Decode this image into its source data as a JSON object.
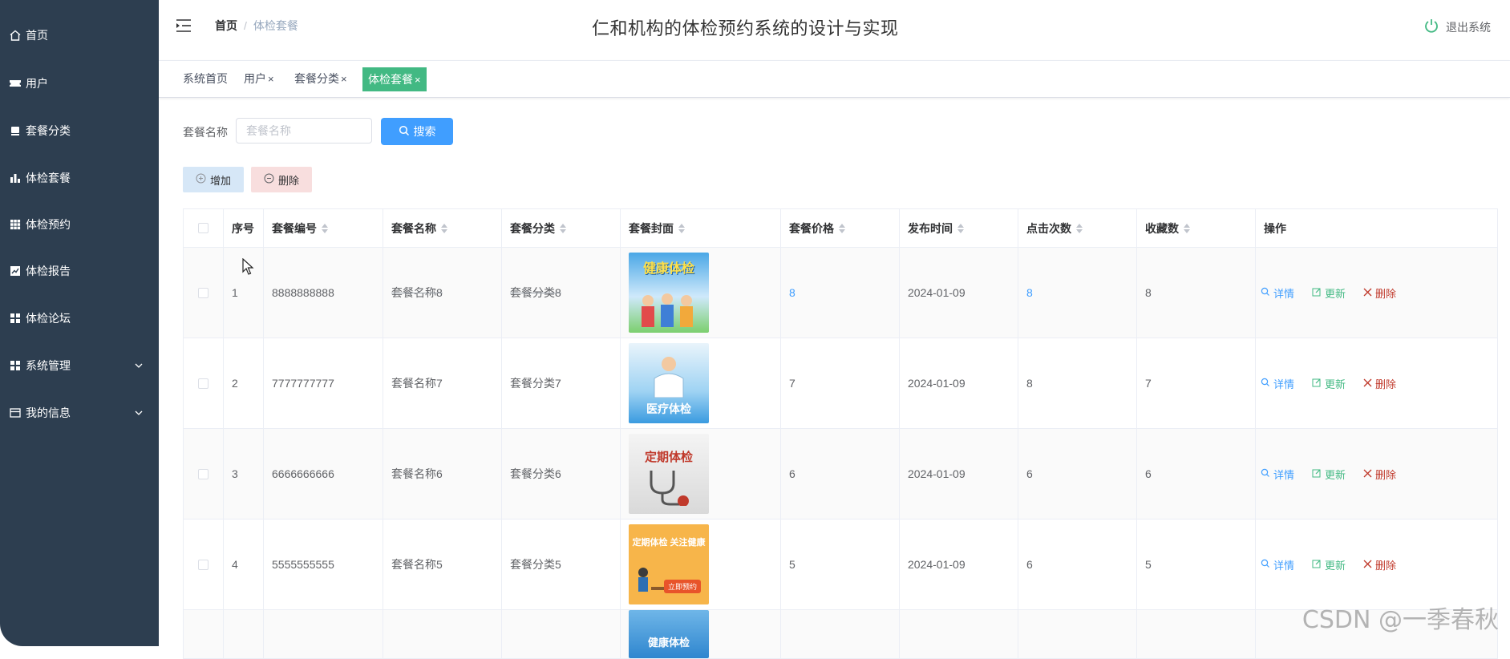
{
  "sidebar": {
    "items": [
      {
        "label": "首页",
        "icon": "home-icon"
      },
      {
        "label": "用户",
        "icon": "ticket-icon"
      },
      {
        "label": "套餐分类",
        "icon": "tag-icon"
      },
      {
        "label": "体检套餐",
        "icon": "bar-chart-icon"
      },
      {
        "label": "体检预约",
        "icon": "grid-icon"
      },
      {
        "label": "体检报告",
        "icon": "chart-box-icon"
      },
      {
        "label": "体检论坛",
        "icon": "apps-icon"
      },
      {
        "label": "系统管理",
        "icon": "apps-icon"
      },
      {
        "label": "我的信息",
        "icon": "card-icon"
      }
    ]
  },
  "header": {
    "breadcrumb_home": "首页",
    "breadcrumb_sep": "/",
    "breadcrumb_current": "体检套餐",
    "title": "仁和机构的体检预约系统的设计与实现",
    "logout": "退出系统"
  },
  "tags": [
    {
      "label": "系统首页",
      "closable": false
    },
    {
      "label": "用户",
      "closable": true
    },
    {
      "label": "套餐分类",
      "closable": true
    },
    {
      "label": "体检套餐",
      "closable": true,
      "active": true
    }
  ],
  "tag_close": "×",
  "search": {
    "label": "套餐名称",
    "placeholder": "套餐名称",
    "button": "搜索"
  },
  "actions": {
    "add": "增加",
    "delete": "删除"
  },
  "table": {
    "headers": {
      "index": "序号",
      "code": "套餐编号",
      "name": "套餐名称",
      "category": "套餐分类",
      "cover": "套餐封面",
      "price": "套餐价格",
      "publish": "发布时间",
      "clicks": "点击次数",
      "favorites": "收藏数",
      "ops": "操作"
    },
    "rows": [
      {
        "index": "1",
        "code": "8888888888",
        "name": "套餐名称8",
        "category": "套餐分类8",
        "price": "8",
        "publish": "2024-01-09",
        "clicks": "8",
        "favorites": "8",
        "cover_text": "健康体检"
      },
      {
        "index": "2",
        "code": "7777777777",
        "name": "套餐名称7",
        "category": "套餐分类7",
        "price": "7",
        "publish": "2024-01-09",
        "clicks": "8",
        "favorites": "7",
        "cover_text": "医疗体检"
      },
      {
        "index": "3",
        "code": "6666666666",
        "name": "套餐名称6",
        "category": "套餐分类6",
        "price": "6",
        "publish": "2024-01-09",
        "clicks": "6",
        "favorites": "6",
        "cover_text": "定期体检"
      },
      {
        "index": "4",
        "code": "5555555555",
        "name": "套餐名称5",
        "category": "套餐分类5",
        "price": "5",
        "publish": "2024-01-09",
        "clicks": "6",
        "favorites": "5",
        "cover_text": "定期体检 关注健康",
        "cover_button": "立即预约"
      }
    ],
    "row_actions": {
      "detail": "详情",
      "update": "更新",
      "delete": "删除"
    },
    "partial_cover_text": "健康体检"
  },
  "watermark": "CSDN @一季春秋",
  "colors": {
    "sidebar_bg": "#2d3e50",
    "primary": "#409eff",
    "success": "#42b983",
    "danger": "#c0392b"
  }
}
